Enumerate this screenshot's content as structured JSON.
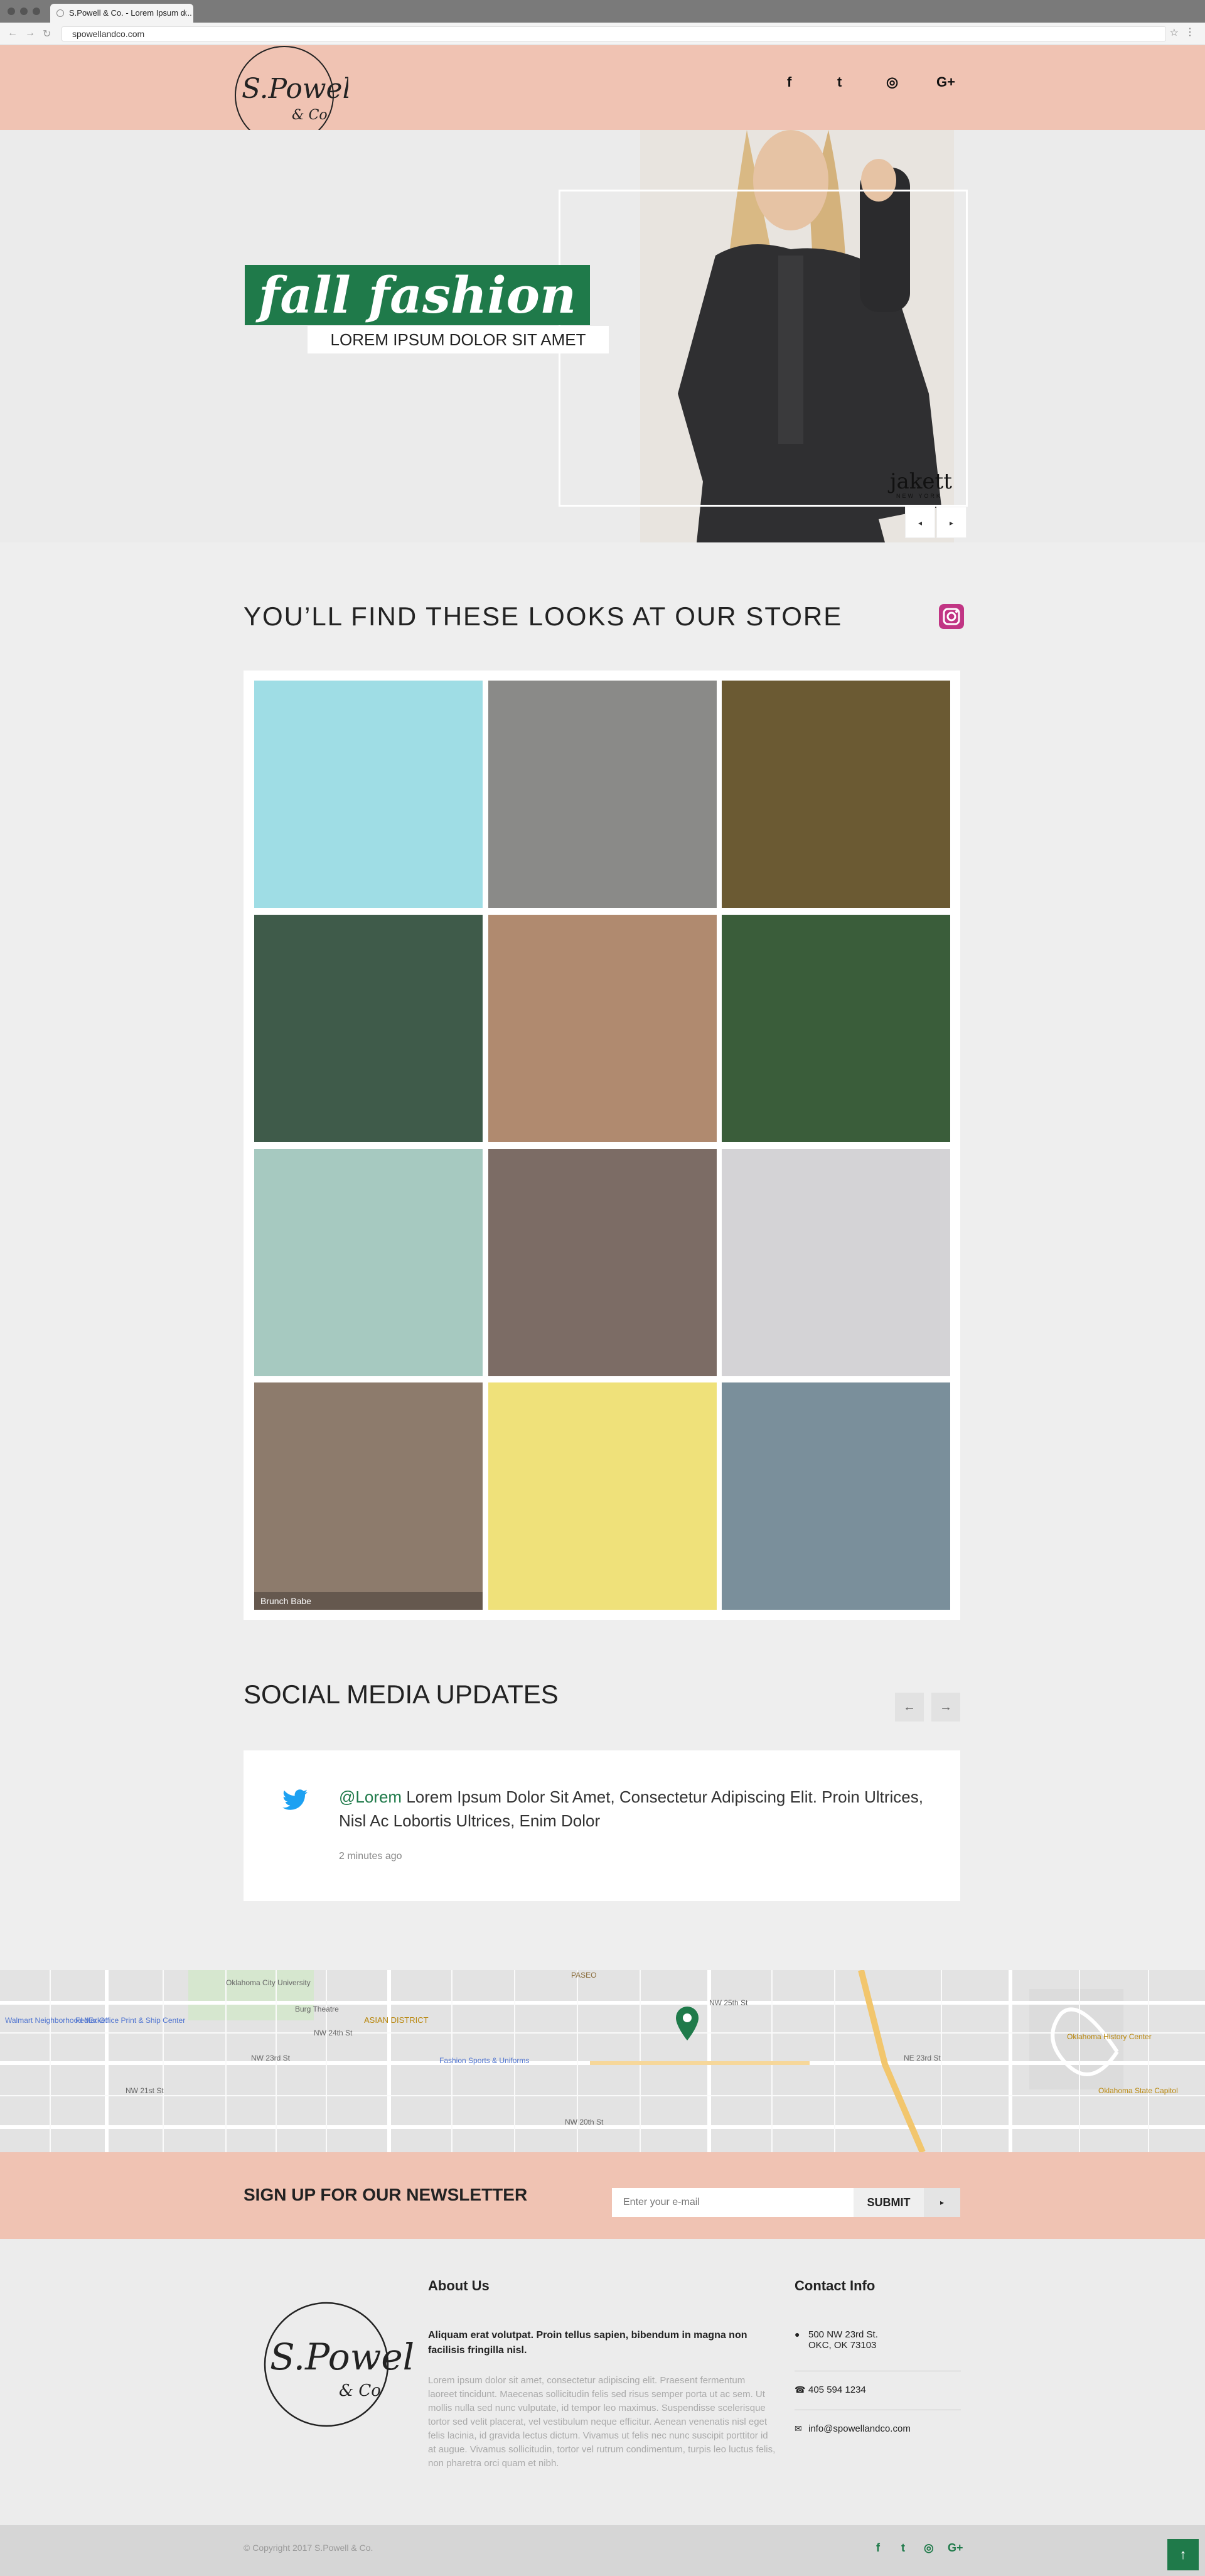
{
  "browser": {
    "tab_title": "S.Powell & Co. - Lorem Ipsum d...",
    "tab_close": "×",
    "url": "spowellandco.com",
    "back": "←",
    "forward": "→",
    "reload": "↻",
    "star": "☆",
    "menu": "⋮"
  },
  "header": {
    "logo_text": "S.Powell",
    "logo_sub": "& Co",
    "social": [
      "f",
      "t",
      "◎",
      "G+"
    ]
  },
  "hero": {
    "title": "fall fashion",
    "subtitle": "LOREM IPSUM DOLOR SIT AMET",
    "brand": "jakett",
    "brand_sub": "NEW YORK",
    "prev": "◂",
    "next": "▸"
  },
  "looks": {
    "title": "YOU’LL FIND THESE LOOKS AT OUR STORE",
    "tiles": [
      {
        "label": "",
        "color": "#9fdde5"
      },
      {
        "label": "",
        "color": "#8a8a88"
      },
      {
        "label": "",
        "color": "#6b5a33"
      },
      {
        "label": "",
        "color": "#3f5b4a"
      },
      {
        "label": "",
        "color": "#b08a6f"
      },
      {
        "label": "",
        "color": "#3a5d3a"
      },
      {
        "label": "",
        "color": "#a6c9c0"
      },
      {
        "label": "",
        "color": "#7c6c65"
      },
      {
        "label": "",
        "color": "#d4d3d6"
      },
      {
        "label": "Brunch Babe",
        "color": "#8d7b6c"
      },
      {
        "label": "",
        "color": "#efe17a"
      },
      {
        "label": "",
        "color": "#7a8f9b"
      }
    ]
  },
  "social": {
    "title": "SOCIAL MEDIA UPDATES",
    "prev": "←",
    "next": "→",
    "tweet": {
      "handle": "@Lorem",
      "text": "Lorem Ipsum Dolor Sit Amet, Consectetur Adipiscing Elit. Proin Ultrices, Nisl Ac Lobortis Ultrices, Enim Dolor",
      "time": "2 minutes ago"
    }
  },
  "map": {
    "labels": [
      "Oklahoma City University",
      "ASIAN DISTRICT",
      "PASEO",
      "Burg Theatre",
      "FedEx Office Print & Ship Center",
      "Walmart Neighborhood Market",
      "Fashion Sports & Uniforms",
      "Oklahoma History Center",
      "Oklahoma State Capitol",
      "NW 23rd St",
      "NW 24th St",
      "NW 25th St",
      "NW 21st St",
      "NW 20th St",
      "NE 23rd St"
    ]
  },
  "newsletter": {
    "title": "SIGN UP FOR OUR NEWSLETTER",
    "placeholder": "Enter your e-mail",
    "submit": "SUBMIT",
    "arrow": "▸"
  },
  "footer": {
    "about_title": "About Us",
    "about_lead": "Aliquam erat volutpat. Proin tellus sapien, bibendum in magna non facilisis fringilla nisl.",
    "about_body": "Lorem ipsum dolor sit amet, consectetur adipiscing elit. Praesent fermentum laoreet tincidunt. Maecenas sollicitudin felis sed risus semper porta ut ac sem. Ut mollis nulla sed nunc vulputate, id tempor leo maximus. Suspendisse scelerisque tortor sed velit placerat, vel vestibulum neque efficitur. Aenean venenatis nisl eget felis lacinia, id gravida lectus dictum. Vivamus ut felis nec nunc suscipit porttitor id at augue. Vivamus sollicitudin, tortor vel rutrum condimentum, turpis leo luctus felis, non pharetra orci quam et nibh.",
    "contact_title": "Contact Info",
    "address_line1": "500 NW 23rd St.",
    "address_line2": "OKC, OK 73103",
    "phone": "405 594 1234",
    "email": "info@spowellandco.com"
  },
  "bottom": {
    "copyright": "© Copyright 2017 S.Powell & Co.",
    "social": [
      "f",
      "t",
      "◎",
      "G+"
    ],
    "to_top": "↑"
  }
}
